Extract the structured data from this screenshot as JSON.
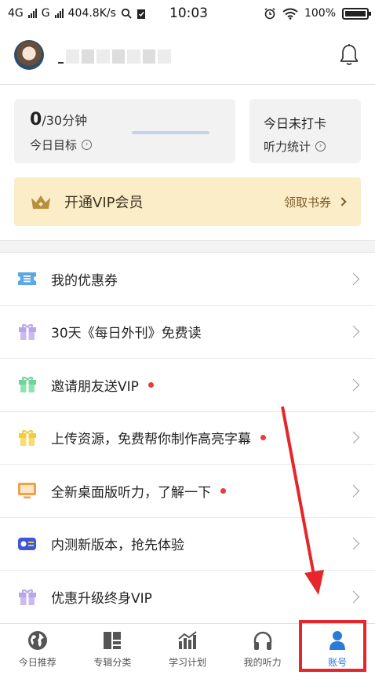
{
  "status_bar": {
    "network_1": "4G",
    "network_2": "G",
    "speed": "404.8K/s",
    "time": "10:03",
    "battery": "100%",
    "icons": [
      "signal-icon",
      "search-icon",
      "clipboard-icon",
      "alarm-icon",
      "wifi-icon",
      "battery-icon"
    ]
  },
  "profile": {
    "username": "_",
    "avatar_icon": "cat-avatar",
    "bell_icon": "bell-icon"
  },
  "goal_card": {
    "current": "0",
    "target": "/30分钟",
    "label": "今日目标",
    "progress": 0
  },
  "stats_card": {
    "status": "今日未打卡",
    "label": "听力统计"
  },
  "vip_banner": {
    "title": "开通VIP会员",
    "cta": "领取书券",
    "icon": "crown-icon"
  },
  "list": {
    "items": [
      {
        "label": "我的优惠券",
        "icon": "coupon-icon",
        "color": "#5aa9e6",
        "dot": false
      },
      {
        "label": "30天《每日外刊》免费读",
        "icon": "gift-icon",
        "color": "#b8a6e8",
        "dot": false
      },
      {
        "label": "邀请朋友送VIP",
        "icon": "gift-icon",
        "color": "#7fd9a5",
        "dot": true
      },
      {
        "label": "上传资源，免费帮你制作高亮字幕",
        "icon": "gift-icon",
        "color": "#f5d24a",
        "dot": true
      },
      {
        "label": "全新桌面版听力，了解一下",
        "icon": "monitor-icon",
        "color": "#f0a14a",
        "dot": true
      },
      {
        "label": "内测新版本，抢先体验",
        "icon": "radio-icon",
        "color": "#3c58d6",
        "dot": false
      },
      {
        "label": "优惠升级终身VIP",
        "icon": "gift-icon",
        "color": "#b8a6e8",
        "dot": false
      }
    ]
  },
  "tabbar": {
    "tabs": [
      {
        "label": "今日推荐",
        "icon": "globe-icon"
      },
      {
        "label": "专辑分类",
        "icon": "grid-icon"
      },
      {
        "label": "学习计划",
        "icon": "chart-icon"
      },
      {
        "label": "我的听力",
        "icon": "headphones-icon"
      },
      {
        "label": "账号",
        "icon": "person-icon"
      }
    ],
    "active_index": 4
  },
  "colors": {
    "accent": "#2a7ad8",
    "vip_bg": "#fbedc8",
    "annotation": "#e5262b",
    "badge_dot": "#e83c3c"
  }
}
